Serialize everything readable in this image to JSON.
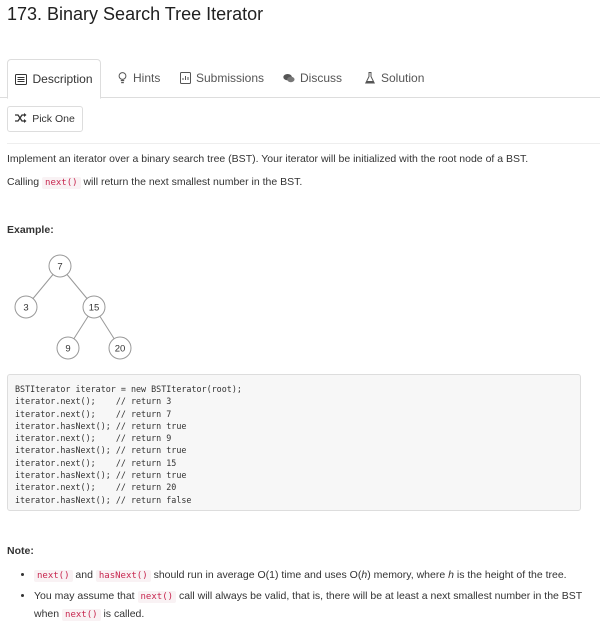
{
  "page": {
    "title": "173. Binary Search Tree Iterator"
  },
  "tabs": [
    {
      "label": "Description",
      "icon": "description-icon",
      "active": true
    },
    {
      "label": "Hints",
      "icon": "lightbulb-icon",
      "active": false
    },
    {
      "label": "Submissions",
      "icon": "submissions-icon",
      "active": false
    },
    {
      "label": "Discuss",
      "icon": "discuss-icon",
      "active": false
    },
    {
      "label": "Solution",
      "icon": "flask-icon",
      "active": false
    }
  ],
  "pick_button": {
    "label": "Pick One",
    "icon": "shuffle-icon"
  },
  "description": {
    "p1": "Implement an iterator over a binary search tree (BST). Your iterator will be initialized with the root node of a BST.",
    "p2_before": "Calling ",
    "p2_code": "next()",
    "p2_after": " will return the next smallest number in the BST."
  },
  "example": {
    "heading": "Example:",
    "tree_nodes": [
      "7",
      "3",
      "15",
      "9",
      "20"
    ],
    "code_lines": [
      "BSTIterator iterator = new BSTIterator(root);",
      "iterator.next();    // return 3",
      "iterator.next();    // return 7",
      "iterator.hasNext(); // return true",
      "iterator.next();    // return 9",
      "iterator.hasNext(); // return true",
      "iterator.next();    // return 15",
      "iterator.hasNext(); // return true",
      "iterator.next();    // return 20",
      "iterator.hasNext(); // return false"
    ]
  },
  "note": {
    "heading": "Note:",
    "item1": {
      "code1": "next()",
      "mid1": " and ",
      "code2": "hasNext()",
      "text_a": " should run in average O(1) time and uses O(",
      "h": "h",
      "text_b": ") memory, where ",
      "h2": "h",
      "text_c": " is the height of the tree."
    },
    "item2": {
      "text_a": "You may assume that ",
      "code1": "next()",
      "text_b": " call will always be valid, that is, there will be at least a next smallest number in the BST when ",
      "code2": "next()",
      "text_c": " is called."
    }
  },
  "colors": {
    "code_text": "#c7254e",
    "code_bg": "#f9f2f4",
    "border": "#dddddd"
  }
}
